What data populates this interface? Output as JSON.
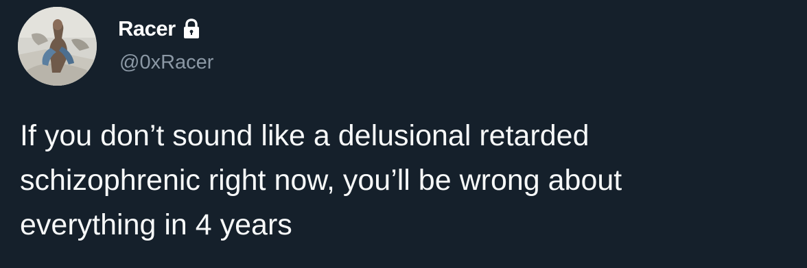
{
  "author": {
    "display_name": "Racer",
    "handle": "@0xRacer",
    "protected_icon": "lock-icon",
    "avatar_icon": "avatar-photo"
  },
  "tweet": {
    "text": "If you don’t sound like a delusional retarded\nschizophrenic right now, you’ll be wrong about\neverything in 4 years"
  },
  "colors": {
    "background": "#15202b",
    "text": "#f7f9f9",
    "secondary_text": "#8b98a5"
  }
}
